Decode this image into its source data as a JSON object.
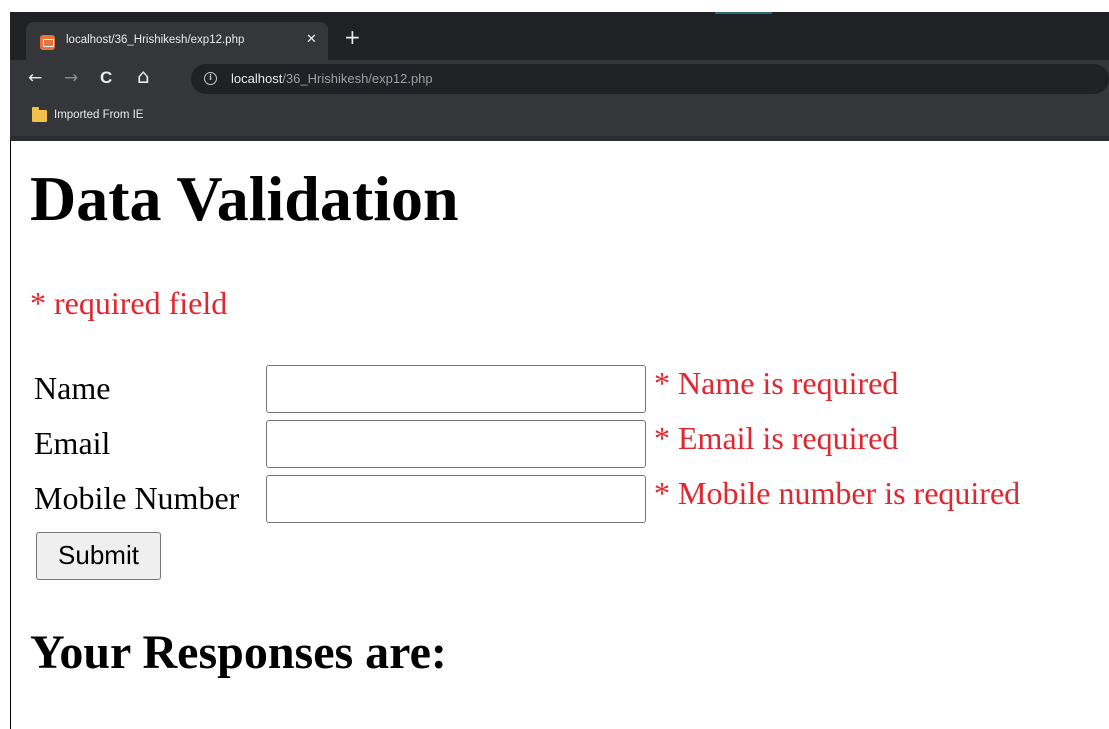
{
  "browser": {
    "tab": {
      "title": "localhost/36_Hrishikesh/exp12.php",
      "close_glyph": "✕"
    },
    "new_tab_glyph": "+",
    "nav": {
      "back_glyph": "←",
      "forward_glyph": "→",
      "reload_glyph": "C",
      "home_glyph": "⌂"
    },
    "address": {
      "info_glyph": "i",
      "host": "localhost",
      "path": "/36_Hrishikesh/exp12.php"
    },
    "bookmarks_bar": {
      "items": [
        {
          "label": "Imported From IE",
          "icon": "folder-icon"
        }
      ]
    },
    "colors": {
      "tabstrip": "#202124",
      "toolbar": "#35363a",
      "favicon": "#e8733b",
      "folder": "#f3c04b"
    }
  },
  "page": {
    "title": "Data Validation",
    "required_note": "* required field",
    "form": {
      "fields": [
        {
          "label": "Name",
          "value": "",
          "error": "* Name is required"
        },
        {
          "label": "Email",
          "value": "",
          "error": "* Email is required"
        },
        {
          "label": "Mobile Number",
          "value": "",
          "error": "* Mobile number is required"
        }
      ],
      "submit_label": "Submit"
    },
    "responses_heading": "Your Responses are:",
    "colors": {
      "error": "#e0272f",
      "text": "#000000"
    }
  }
}
